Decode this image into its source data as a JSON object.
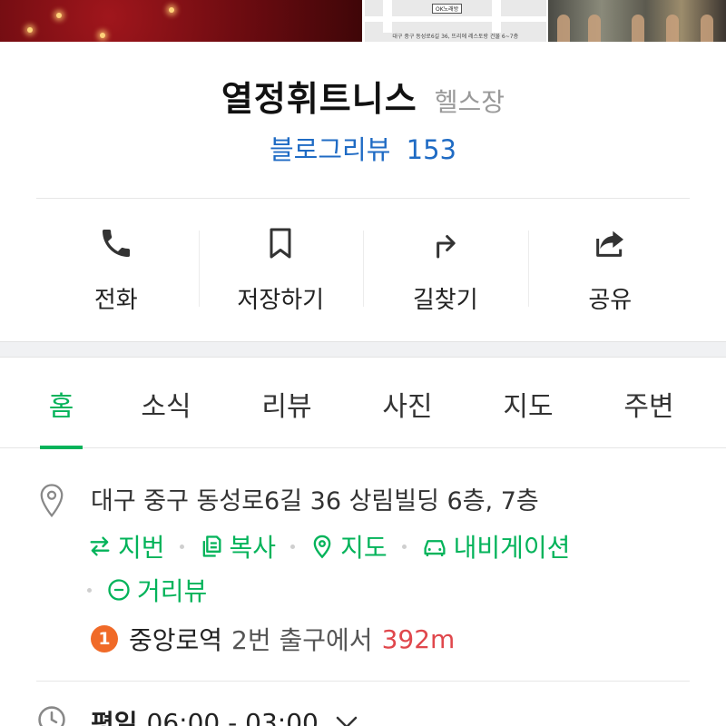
{
  "photos": {
    "map_caption": "대구 중구 동성로6길 36, 뜨리에 레스토랑 건물 6~7층",
    "map_pin_label": "OK노래방"
  },
  "place": {
    "name": "열정휘트니스",
    "category": "헬스장",
    "review_label": "블로그리뷰",
    "review_count": "153"
  },
  "actions": [
    {
      "label": "전화",
      "icon": "phone-icon"
    },
    {
      "label": "저장하기",
      "icon": "bookmark-icon"
    },
    {
      "label": "길찾기",
      "icon": "directions-icon"
    },
    {
      "label": "공유",
      "icon": "share-icon"
    }
  ],
  "tabs": [
    {
      "label": "홈",
      "active": true
    },
    {
      "label": "소식",
      "active": false
    },
    {
      "label": "리뷰",
      "active": false
    },
    {
      "label": "사진",
      "active": false
    },
    {
      "label": "지도",
      "active": false
    },
    {
      "label": "주변",
      "active": false
    }
  ],
  "info": {
    "address": "대구 중구 동성로6길 36 상림빌딩 6층, 7층",
    "links": {
      "lot_number": "지번",
      "copy": "복사",
      "map": "지도",
      "navigation": "내비게이션",
      "street_view": "거리뷰"
    },
    "subway": {
      "line": "1",
      "station": "중앙로역",
      "exit": "2번 출구에서",
      "distance": "392m"
    },
    "hours": {
      "day": "평일",
      "time": "06:00 - 03:00"
    }
  },
  "colors": {
    "accent_green": "#03b35a",
    "link_blue": "#1f6bc4",
    "distance_red": "#e0474c",
    "line1_orange": "#f06a28"
  }
}
